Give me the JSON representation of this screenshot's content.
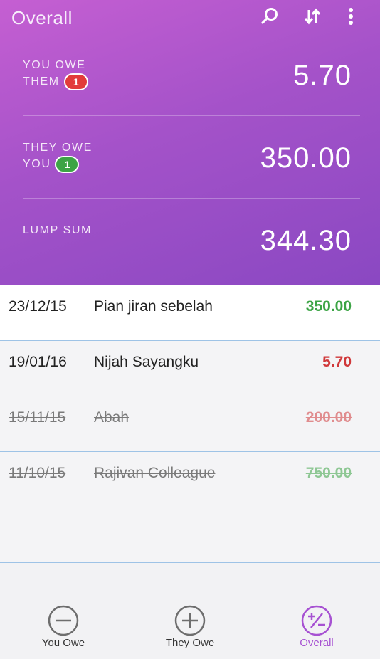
{
  "header": {
    "title": "Overall",
    "icons": [
      "search-icon",
      "sort-icon",
      "more-vertical-icon"
    ]
  },
  "summary": {
    "you_owe": {
      "label_line1": "YOU OWE",
      "label_line2": "THEM",
      "badge": "1",
      "badge_color": "#e23b3b",
      "value": "5.70"
    },
    "they_owe": {
      "label_line1": "THEY OWE",
      "label_line2": "YOU",
      "badge": "1",
      "badge_color": "#3ca445",
      "value": "350.00"
    },
    "lump_sum": {
      "label": "LUMP SUM",
      "value": "344.30"
    }
  },
  "transactions": [
    {
      "date": "23/12/15",
      "name": "Pian jiran sebelah",
      "amount": "350.00",
      "color": "#3ca445",
      "settled": false
    },
    {
      "date": "19/01/16",
      "name": "Nijah Sayangku",
      "amount": "5.70",
      "color": "#d0383a",
      "settled": false
    },
    {
      "date": "15/11/15",
      "name": "Abah",
      "amount": "200.00",
      "color": "#d0383a",
      "settled": true
    },
    {
      "date": "11/10/15",
      "name": "Rajivan Colleague",
      "amount": "750.00",
      "color": "#3ca445",
      "settled": true
    }
  ],
  "tabs": [
    {
      "label": "You Owe",
      "icon": "minus-circle-icon",
      "active": false
    },
    {
      "label": "They Owe",
      "icon": "plus-circle-icon",
      "active": false
    },
    {
      "label": "Overall",
      "icon": "plus-minus-circle-icon",
      "active": true
    }
  ],
  "colors": {
    "accent": "#a752d2",
    "positive": "#3ca445",
    "negative": "#d0383a"
  }
}
